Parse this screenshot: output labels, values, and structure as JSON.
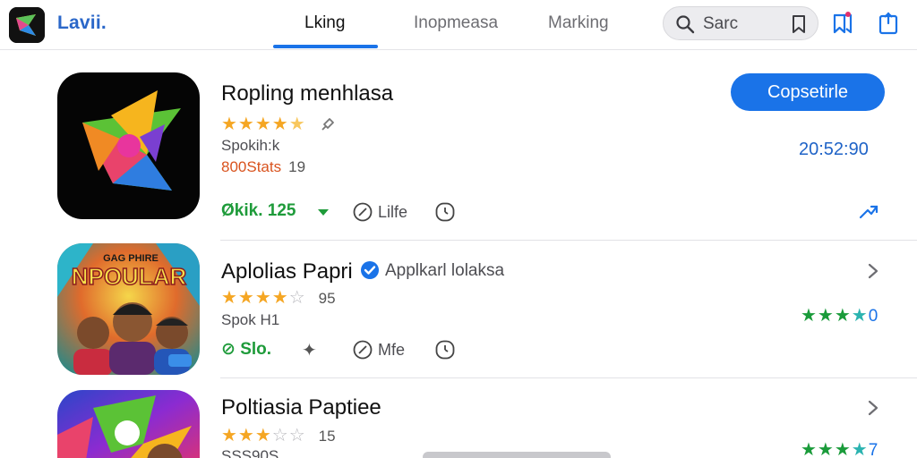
{
  "header": {
    "brand": "Lavii.",
    "tabs": [
      {
        "label": "Lking",
        "active": true
      },
      {
        "label": "Inopmeasa",
        "active": false
      },
      {
        "label": "Marking",
        "active": false
      }
    ],
    "search": {
      "text": "Sarc",
      "icon": "search-icon"
    },
    "icons": [
      "bookmark-icon",
      "bookmark-flag-icon",
      "share-icon"
    ],
    "accent": "#1a73e8"
  },
  "apps": [
    {
      "name": "Ropling menhlasa",
      "rating_stars": "★★★★",
      "rating_half": "★",
      "sub1": "Spokih:k",
      "sub2": "800Stats",
      "sub2_extra": "19",
      "meta_green": "Økik. 125",
      "meta_label": "Lilfe",
      "action_label": "Copsetirle",
      "time": "20:52:90"
    },
    {
      "name": "Aplolias Papri",
      "badge_text": "Applkarl lolaksa",
      "rating_stars": "★★★★",
      "rating_empty": "☆",
      "rating_count": "95",
      "sub1": "Spok H1",
      "meta_green": "⊘ Slo.",
      "meta_label": "Mfe",
      "icon_text": "NPOULAR",
      "icon_subtext": "GAG PHIRE",
      "right_rating_stars": "★★★",
      "right_rating_teal": "★",
      "right_rating_num": "0"
    },
    {
      "name": "Poltiasia Paptiee",
      "rating_stars": "★★★",
      "rating_empty": "☆☆",
      "rating_count": "15",
      "sub1": "SSS90S",
      "right_rating_stars": "★★★",
      "right_rating_teal": "★",
      "right_rating_num": "7"
    }
  ]
}
